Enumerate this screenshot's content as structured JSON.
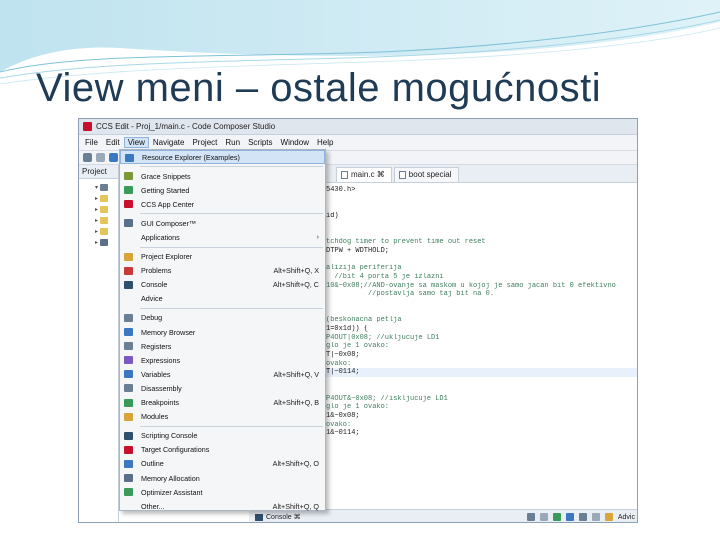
{
  "slide": {
    "title": "View meni – ostale mogućnosti"
  },
  "ide": {
    "window_title": "CCS Edit - Proj_1/main.c - Code Composer Studio",
    "menubar": [
      "File",
      "Edit",
      "View",
      "Navigate",
      "Project",
      "Run",
      "Scripts",
      "Window",
      "Help"
    ],
    "active_menu": "View",
    "explorer_tab": "Project",
    "editor_tabs": [
      {
        "label": "main.c ⌘",
        "selected": true
      },
      {
        "label": "boot special",
        "selected": false
      }
    ],
    "code_lines": [
      {
        "text": "5430.h>",
        "style": "code"
      },
      {
        "text": "",
        "style": "code"
      },
      {
        "text": "",
        "style": "code"
      },
      {
        "text": "id)",
        "style": "code"
      },
      {
        "text": "",
        "style": "code"
      },
      {
        "text": "",
        "style": "code"
      },
      {
        "text": "tchdog timer to prevent time out reset",
        "style": "comment"
      },
      {
        "text": "DTPW + WDTHOLD;",
        "style": "code"
      },
      {
        "text": "",
        "style": "code"
      },
      {
        "text": "alizija periferija",
        "style": "comment"
      },
      {
        "text": "  //bit 4 porta 5 je izlazni",
        "style": "comment"
      },
      {
        "text": "10&~0x08;//AND-ovanje sa maskom u kojoj je samo jacan bit 0 efektivno",
        "style": "comment"
      },
      {
        "text": "          //postavlja samo taj bit na 0.",
        "style": "comment"
      },
      {
        "text": "",
        "style": "code"
      },
      {
        "text": "",
        "style": "code"
      },
      {
        "text": "(beskonacna petlja",
        "style": "comment"
      },
      {
        "text": "1=0x1d)) {",
        "style": "code"
      },
      {
        "text": "P4OUT|0x08; //ukljucuje LD1",
        "style": "comment"
      },
      {
        "text": "glo je 1 ovako:",
        "style": "comment"
      },
      {
        "text": "T|~0x08;",
        "style": "code"
      },
      {
        "text": "ovako:",
        "style": "comment"
      },
      {
        "text": "T|~0114;",
        "style": "code",
        "highlight": true
      },
      {
        "text": "",
        "style": "code"
      },
      {
        "text": "",
        "style": "code"
      },
      {
        "text": "P4OUT&~0x08; //iskljucuje LD1",
        "style": "comment"
      },
      {
        "text": "glo je 1 ovako:",
        "style": "comment"
      },
      {
        "text": "1&~0x08;",
        "style": "code"
      },
      {
        "text": "ovako:",
        "style": "comment"
      },
      {
        "text": "1&~0114;",
        "style": "code"
      }
    ],
    "status": {
      "console_label": "Console ⌘",
      "advice_label": "Advic"
    }
  },
  "view_menu": {
    "groups": [
      [
        {
          "label": "Resource Explorer (Examples)",
          "shortcut": "",
          "icon": "resource-explorer-icon",
          "color": "#3a78c2"
        }
      ],
      [
        {
          "label": "Grace Snippets",
          "shortcut": "",
          "icon": "grace-snippets-icon",
          "color": "#7a9a3a"
        },
        {
          "label": "Getting Started",
          "shortcut": "",
          "icon": "getting-started-icon",
          "color": "#3a9a5a"
        },
        {
          "label": "CCS App Center",
          "shortcut": "",
          "icon": "app-center-icon",
          "color": "#c8102e"
        }
      ],
      [
        {
          "label": "GUI Composer™",
          "shortcut": "",
          "icon": "gui-composer-icon",
          "color": "#5a6f8a"
        },
        {
          "label": "Applications",
          "shortcut": "",
          "submenu": true,
          "icon": "applications-icon",
          "color": "#f5f6f8"
        }
      ],
      [
        {
          "label": "Project Explorer",
          "shortcut": "",
          "icon": "project-explorer-icon",
          "color": "#d8a53a"
        },
        {
          "label": "Problems",
          "shortcut": "Alt+Shift+Q, X",
          "icon": "problems-icon",
          "color": "#c83a3a"
        },
        {
          "label": "Console",
          "shortcut": "Alt+Shift+Q, C",
          "icon": "console-icon",
          "color": "#2f4f6f"
        },
        {
          "label": "Advice",
          "shortcut": "",
          "icon": "advice-icon",
          "color": "#f5f6f8"
        }
      ],
      [
        {
          "label": "Debug",
          "shortcut": "",
          "icon": "debug-icon",
          "color": "#6a7f94"
        },
        {
          "label": "Memory Browser",
          "shortcut": "",
          "icon": "memory-browser-icon",
          "color": "#3a78c2"
        },
        {
          "label": "Registers",
          "shortcut": "",
          "icon": "registers-icon",
          "color": "#6a7f94"
        },
        {
          "label": "Expressions",
          "shortcut": "",
          "icon": "expressions-icon",
          "color": "#7a5ac2"
        },
        {
          "label": "Variables",
          "shortcut": "Alt+Shift+Q, V",
          "icon": "variables-icon",
          "color": "#3a78c2"
        },
        {
          "label": "Disassembly",
          "shortcut": "",
          "icon": "disassembly-icon",
          "color": "#6a7f94"
        },
        {
          "label": "Breakpoints",
          "shortcut": "Alt+Shift+Q, B",
          "icon": "breakpoints-icon",
          "color": "#3a9a5a"
        },
        {
          "label": "Modules",
          "shortcut": "",
          "icon": "modules-icon",
          "color": "#d8a53a"
        }
      ],
      [
        {
          "label": "Scripting Console",
          "shortcut": "",
          "icon": "scripting-console-icon",
          "color": "#2f4f6f"
        },
        {
          "label": "Target Configurations",
          "shortcut": "",
          "icon": "target-configurations-icon",
          "color": "#c8102e"
        },
        {
          "label": "Outline",
          "shortcut": "Alt+Shift+Q, O",
          "icon": "outline-icon",
          "color": "#3a78c2"
        },
        {
          "label": "Memory Allocation",
          "shortcut": "",
          "icon": "memory-allocation-icon",
          "color": "#5a6f8a"
        },
        {
          "label": "Optimizer Assistant",
          "shortcut": "",
          "icon": "optimizer-assistant-icon",
          "color": "#3a9a5a"
        },
        {
          "label": "Other...",
          "shortcut": "Alt+Shift+Q, Q",
          "icon": "other-icon",
          "color": "#f5f6f8"
        }
      ]
    ]
  }
}
